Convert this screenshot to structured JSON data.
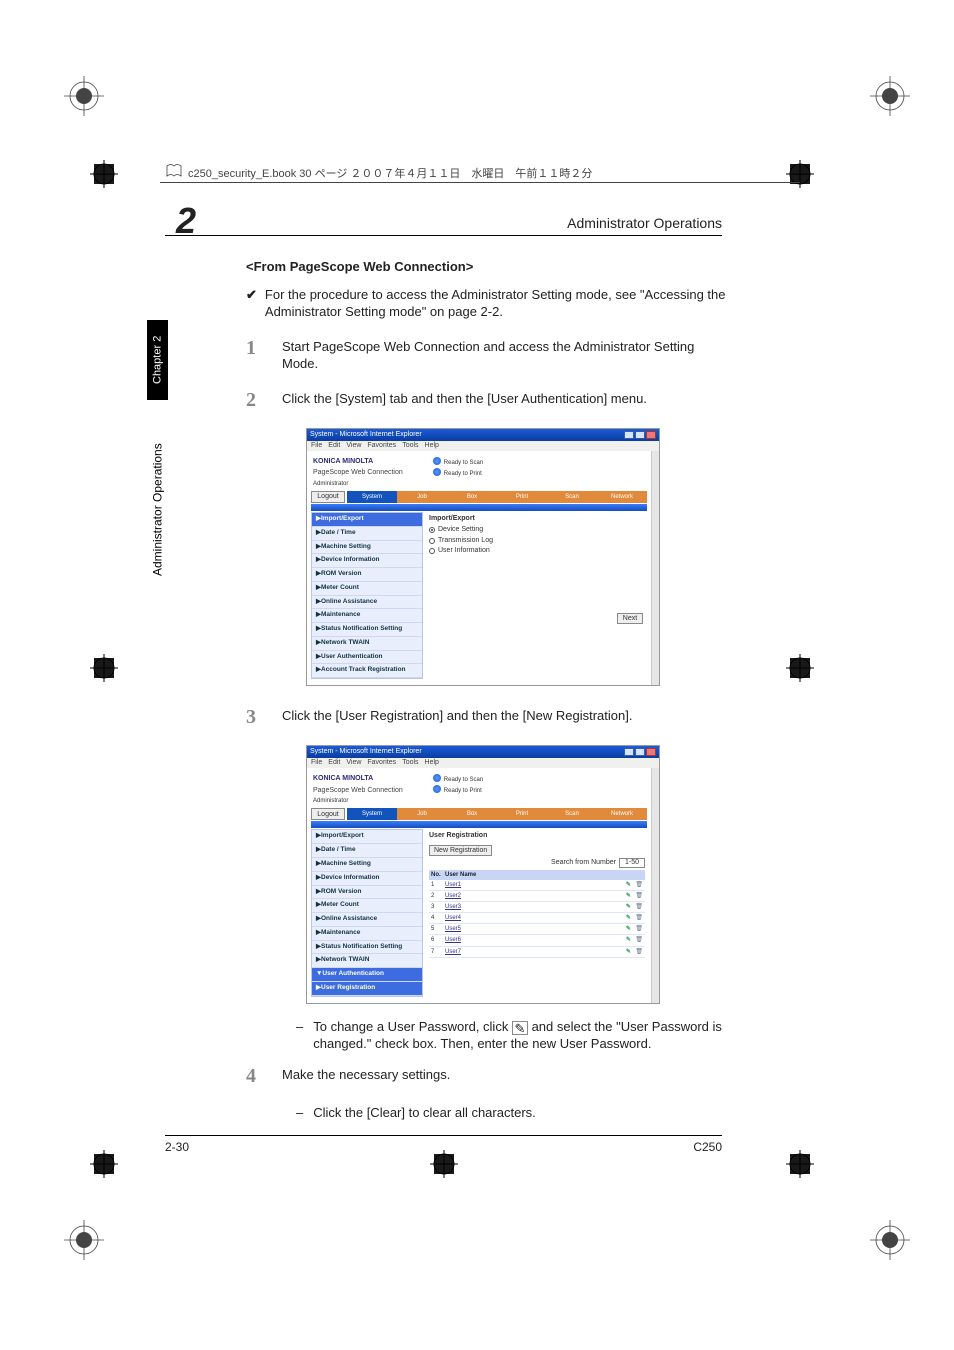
{
  "page_header": {
    "text": "c250_security_E.book  30 ページ  ２００７年４月１１日　水曜日　午前１１時２分"
  },
  "section": {
    "title": "Administrator Operations",
    "chapter_num": "2"
  },
  "sidetab": {
    "chapter": "Chapter 2",
    "label": "Administrator Operations"
  },
  "content": {
    "subheading": "<From PageScope Web Connection>",
    "checkmark": "✔",
    "check_text": "For the procedure to access the Administrator Setting mode, see \"Accessing the Administrator Setting mode\" on page 2-2.",
    "step1": {
      "num": "1",
      "text": "Start PageScope Web Connection and access the Administrator Setting Mode."
    },
    "step2": {
      "num": "2",
      "text": "Click the [System] tab and then the [User Authentication] menu."
    },
    "step3": {
      "num": "3",
      "text": "Click the [User Registration] and then the [New Registration]."
    },
    "sub3a": {
      "dash": "–",
      "text_before": "To change a User Password, click ",
      "text_after": " and select the \"User Password is changed.\" check box. Then, enter the new User Password."
    },
    "step4": {
      "num": "4",
      "text": "Make the necessary settings."
    },
    "sub4a": {
      "dash": "–",
      "text": "Click the [Clear] to clear all characters."
    }
  },
  "shot": {
    "title": "System - Microsoft Internet Explorer",
    "menubar": [
      "File",
      "Edit",
      "View",
      "Favorites",
      "Tools",
      "Help"
    ],
    "brand_km": "KONICA MINOLTA",
    "brand_wc": "PageScope Web Connection",
    "status_scan": "Ready to Scan",
    "status_print": "Ready to Print",
    "admin": "Administrator",
    "logout": "Logout",
    "tabs": [
      "System",
      "Job",
      "Box",
      "Print",
      "Scan",
      "Network"
    ],
    "sidemenu1": [
      "▶Import/Export",
      "▶Date / Time",
      "▶Machine Setting",
      "▶Device Information",
      "▶ROM Version",
      "▶Meter Count",
      "▶Online Assistance",
      "▶Maintenance",
      "▶Status Notification Setting",
      "▶Network TWAIN",
      "▶User Authentication",
      "▶Account Track Registration"
    ],
    "panel1": {
      "heading": "Import/Export",
      "opt1": "Device Setting",
      "opt2": "Transmission Log",
      "opt3": "User Information",
      "next": "Next"
    },
    "sidemenu2": [
      "▶Import/Export",
      "▶Date / Time",
      "▶Machine Setting",
      "▶Device Information",
      "▶ROM Version",
      "▶Meter Count",
      "▶Online Assistance",
      "▶Maintenance",
      "▶Status Notification Setting",
      "▶Network TWAIN",
      "▼User Authentication",
      " ▶User Registration"
    ],
    "panel2": {
      "heading": "User Registration",
      "newbtn": "New Registration",
      "search": "Search from Number",
      "range": "1-50",
      "col_no": "No.",
      "col_name": "User Name",
      "rows": [
        {
          "no": "1",
          "name": "User1"
        },
        {
          "no": "2",
          "name": "User2"
        },
        {
          "no": "3",
          "name": "User3"
        },
        {
          "no": "4",
          "name": "User4"
        },
        {
          "no": "5",
          "name": "User5"
        },
        {
          "no": "6",
          "name": "User6"
        },
        {
          "no": "7",
          "name": "User7"
        }
      ]
    }
  },
  "footer": {
    "left": "2-30",
    "right": "C250"
  }
}
